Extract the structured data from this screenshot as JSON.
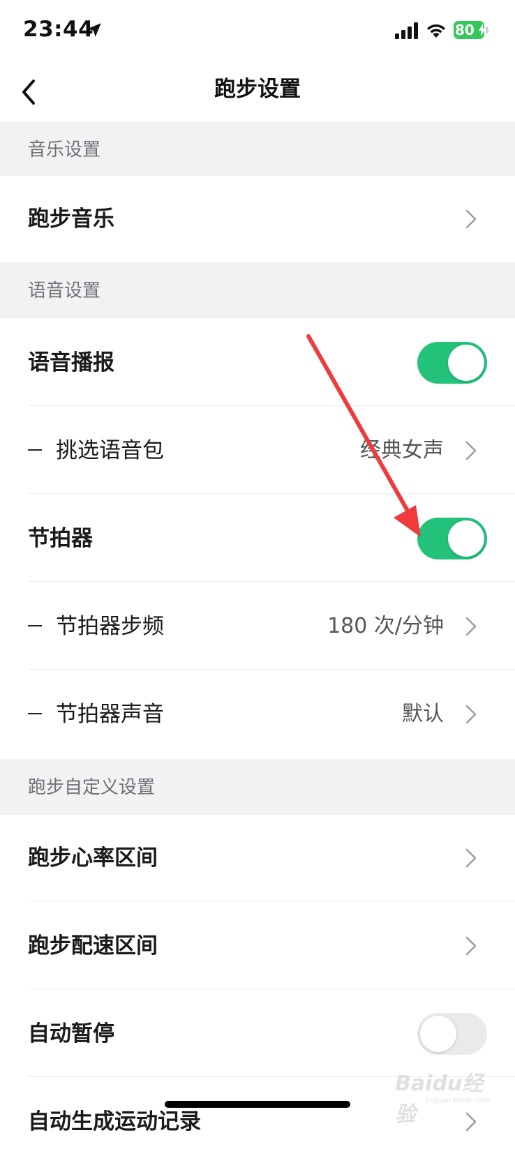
{
  "status_bar": {
    "time": "23:44",
    "battery": "80"
  },
  "nav": {
    "title": "跑步设置"
  },
  "sections": [
    {
      "title": "音乐设置"
    },
    {
      "title": "语音设置"
    },
    {
      "title": "跑步自定义设置"
    }
  ],
  "rows": {
    "running_music": {
      "label": "跑步音乐"
    },
    "voice_broadcast": {
      "label": "语音播报",
      "enabled": true
    },
    "voice_pack": {
      "label": "挑选语音包",
      "value": "经典女声"
    },
    "metronome": {
      "label": "节拍器",
      "enabled": true
    },
    "metronome_cadence": {
      "label": "节拍器步频",
      "value": "180 次/分钟"
    },
    "metronome_sound": {
      "label": "节拍器声音",
      "value": "默认"
    },
    "heart_rate_zones": {
      "label": "跑步心率区间"
    },
    "pace_zones": {
      "label": "跑步配速区间"
    },
    "auto_pause": {
      "label": "自动暂停",
      "enabled": false
    },
    "auto_generate_record": {
      "label": "自动生成运动记录"
    }
  },
  "watermark": {
    "text": "Baidu经验",
    "sub": "jingyan.baidu.com"
  },
  "colors": {
    "toggle_on": "#22c27a",
    "toggle_off": "#eaeaec",
    "annotation_arrow": "#ef3b3b",
    "section_bg": "#f2f2f4"
  }
}
